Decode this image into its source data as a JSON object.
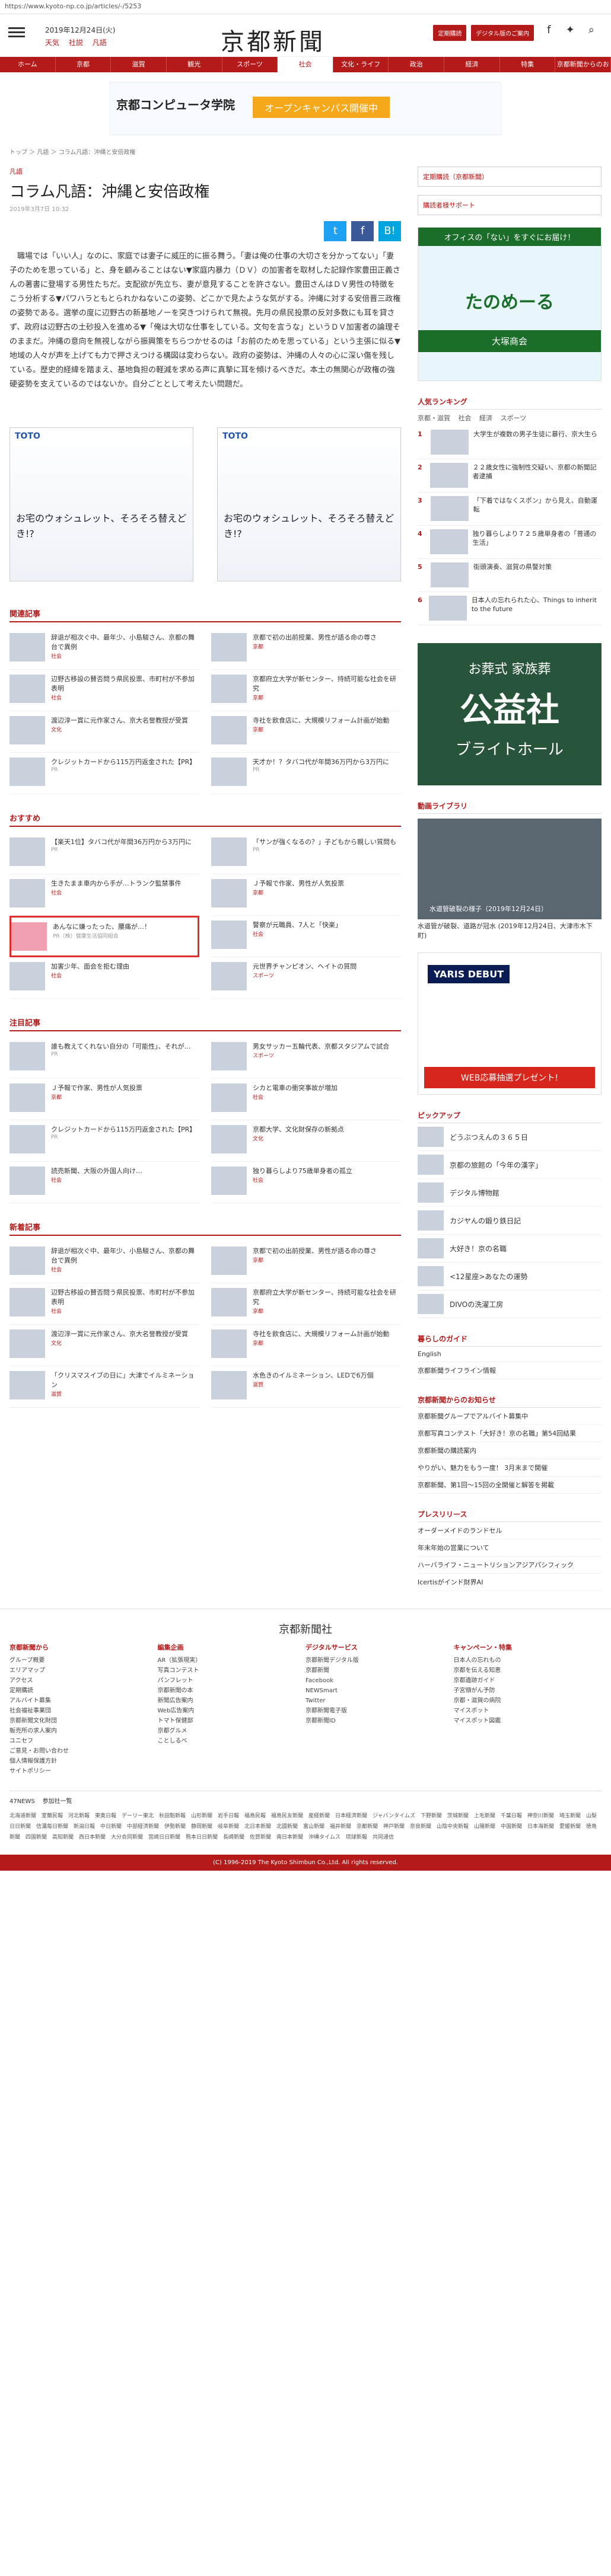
{
  "url": "https://www.kyoto-np.co.jp/articles/-/5253",
  "header": {
    "date": "2019年12月24日(火)",
    "links": [
      "天気",
      "社説",
      "凡語"
    ],
    "logo": "京都新聞",
    "buttons": [
      "定期購読",
      "デジタル版のご案内"
    ],
    "social": [
      "Facebook",
      "Twitter",
      "検索"
    ]
  },
  "nav": [
    "ホーム",
    "京都",
    "滋賀",
    "観光",
    "スポーツ",
    "社会",
    "文化・ライフ",
    "政治",
    "経済",
    "特集",
    "京都新聞からのお知らせ"
  ],
  "ad_banner": {
    "school": "京都コンピュータ学院",
    "text": "オープンキャンパス開催中"
  },
  "breadcrumb": "トップ ＞ 凡語 ＞ コラム凡語：沖縄と安倍政権",
  "article": {
    "category": "凡語",
    "title": "コラム凡語：沖縄と安倍政権",
    "date": "2019年3月7日 10:32",
    "body": "職場では「いい人」なのに、家庭では妻子に威圧的に振る舞う。「妻は俺の仕事の大切さを分かってない」「妻子のためを思っている」と、身を顧みることはない▼家庭内暴力（ＤＶ）の加害者を取材した記録作家豊田正義さんの著書に登場する男性たちだ。支配欲が先立ち、妻が意見することを許さない。豊田さんはＤＶ男性の特徴をこう分析する▼パワハラともとられかねないこの姿勢、どこかで見たような気がする。沖縄に対する安倍晋三政権の姿勢である。選挙の度に辺野古の新基地ノーを突きつけられて無視。先月の県民投票の反対多数にも耳を貸さず、政府は辺野古の土砂投入を進める▼「俺は大切な仕事をしている。文句を言うな」というＤＶ加害者の論理そのままだ。沖縄の意向を無視しながら振興策をちらつかせるのは「お前のためを思っている」という主張に似る▼地域の人々が声を上げても力で押さえつける構図は変わらない。政府の姿勢は、沖縄の人々の心に深い傷を残している。歴史的経緯を踏まえ、基地負担の軽減を求める声に真摯に耳を傾けるべきだ。本土の無関心が政権の強硬姿勢を支えているのではないか。自分ごととして考えたい問題だ。"
  },
  "share": [
    "t",
    "f",
    "B!"
  ],
  "ads_two": [
    {
      "brand": "TOTO",
      "copy": "お宅のウォシュレット、そろそろ替えどき!?"
    },
    {
      "brand": "TOTO",
      "copy": "お宅のウォシュレット、そろそろ替えどき!?"
    }
  ],
  "related": {
    "title": "関連記事",
    "items": [
      {
        "text": "辞退が相次ぐ中、最年少、小島駿さん、京都の舞台で異例",
        "meta": "社会"
      },
      {
        "text": "京都で初の出前授業、男性が語る命の尊さ",
        "meta": "京都"
      },
      {
        "text": "辺野古移設の賛否問う県民投票、市町村が不参加表明",
        "meta": "社会"
      },
      {
        "text": "京都府立大学が新センター、持続可能な社会を研究",
        "meta": "京都"
      },
      {
        "text": "渡辺淳一賞に元作家さん、京大名誉教授が受賞",
        "meta": "文化"
      },
      {
        "text": "寺社を飲食店に、大規模リフォーム計画が始動",
        "meta": "京都"
      },
      {
        "text": "クレジットカードから115万円返金された【PR】",
        "meta": "PR"
      },
      {
        "text": "天才か！？タバコ代が年間36万円から3万円に",
        "meta": "PR"
      }
    ]
  },
  "recommend": {
    "title": "おすすめ",
    "items": [
      {
        "text": "【楽天1位】タバコ代が年間36万円から3万円に",
        "meta": "PR"
      },
      {
        "text": "「サンが強くなるの？」子どもから親しい質問も",
        "meta": "PR"
      },
      {
        "text": "生きたまま車内から手が…トランク監禁事件",
        "meta": "社会"
      },
      {
        "text": "Ｊ予報で作家、男性が人気投票",
        "meta": "京都"
      },
      {
        "text": "あんなに嫌ったった、腰痛が…！",
        "meta": "PR（株）健康生活協同組合"
      },
      {
        "text": "警察が元職員、7人と「快楽」",
        "meta": "社会"
      },
      {
        "text": "加害少年、面会を拒む理由",
        "meta": "社会"
      },
      {
        "text": "元世界チャンピオン、ヘイトの質問",
        "meta": "スポーツ"
      }
    ]
  },
  "featured": {
    "title": "注目記事",
    "items": [
      {
        "text": "誰も教えてくれない自分の「可能性」、それが…",
        "meta": "PR"
      },
      {
        "text": "男女サッカー五輪代表、京都スタジアムで試合",
        "meta": "スポーツ"
      },
      {
        "text": "Ｊ予報で作家、男性が人気投票",
        "meta": "京都"
      },
      {
        "text": "シカと電車の衝突事故が増加",
        "meta": "社会"
      },
      {
        "text": "クレジットカードから115万円返金された【PR】",
        "meta": "PR"
      },
      {
        "text": "京都大学、文化財保存の新拠点",
        "meta": "文化"
      },
      {
        "text": "読売新聞、大阪の外国人向け…",
        "meta": "社会"
      },
      {
        "text": "独り暮らしより75歳単身者の孤立",
        "meta": "社会"
      }
    ]
  },
  "latest": {
    "title": "新着記事",
    "items": [
      {
        "text": "辞退が相次ぐ中、最年少、小島駿さん、京都の舞台で異例",
        "meta": "社会"
      },
      {
        "text": "京都で初の出前授業、男性が語る命の尊さ",
        "meta": "京都"
      },
      {
        "text": "辺野古移設の賛否問う県民投票、市町村が不参加表明",
        "meta": "社会"
      },
      {
        "text": "京都府立大学が新センター、持続可能な社会を研究",
        "meta": "京都"
      },
      {
        "text": "渡辺淳一賞に元作家さん、京大名誉教授が受賞",
        "meta": "文化"
      },
      {
        "text": "寺社を飲食店に、大規模リフォーム計画が始動",
        "meta": "京都"
      },
      {
        "text": "「クリスマスイブの日に」大津でイルミネーション",
        "meta": "滋賀"
      },
      {
        "text": "水色きのイルミネーション、LEDで6万個",
        "meta": "滋賀"
      }
    ]
  },
  "sidebar": {
    "links": [
      "定期購読（京都新聞）",
      "購読者様サポート"
    ],
    "tanomail": {
      "q": "オフィスの「ない」をすぐにお届け！",
      "name": "たのめーる",
      "shop": "大塚商会"
    },
    "ranking": {
      "title": "人気ランキング",
      "tabs": [
        "京都・滋賀",
        "社会",
        "経済",
        "スポーツ"
      ],
      "items": [
        "大学生が複数の男子生徒に暴行、京大生ら",
        "２２歳女性に強制性交疑い、京都の新聞記者逮捕",
        "「下着ではなくスポン」から見え、自動運転",
        "独り暮らしより７２５歳単身者の「普通の生活」",
        "街頭演奏、滋賀の県警対策",
        "日本人の忘れられた心、Things to inherit to the future"
      ]
    },
    "funeral": {
      "t1": "お葬式 家族葬",
      "t2": "公益社",
      "t3": "ブライトホール"
    },
    "video": {
      "title": "動画ライブラリ",
      "cap": "水道管破裂の様子（2019年12月24日）",
      "desc": "水道管が破裂、道路が冠水 (2019年12月24日、大津市木下町)"
    },
    "yaris": {
      "t1": "YARIS DEBUT",
      "t2": "WEB応募抽選プレゼント!"
    },
    "pickup": {
      "title": "ピックアップ",
      "items": [
        "どうぶつえんの３６５日",
        "京都の旅館の「今年の漢字」",
        "デジタル博物館",
        "カジヤんの鍛り鉄日記",
        "大好き！京の名職",
        "<12星座>あなたの運勢",
        "DIVOの洗濯工房"
      ]
    },
    "guide": {
      "title": "暮らしのガイド",
      "items": [
        "English",
        "京都新聞ライフライン情報"
      ]
    },
    "notices": {
      "title": "京都新聞からのお知らせ",
      "items": [
        "京都新聞グループでアルバイト募集中",
        "京都写真コンテスト「大好き！京の名職」第54回結果",
        "京都新聞の購読案内",
        "やりがい、魅力をもう一度！ 3月末まで開催",
        "京都新聞、第1回〜15回の全開催と解答を掲載"
      ]
    },
    "press": {
      "title": "プレスリリース",
      "items": [
        "オーダーメイドのランドセル",
        "年末年始の営業について",
        "ハーバライフ・ニュートリションアジアパシフィック",
        "Icertisがインド財界AI"
      ]
    }
  },
  "footer": {
    "logo": "京都新聞社",
    "cols": [
      {
        "h": "京都新聞から",
        "items": [
          "グループ概要",
          "エリアマップ",
          "アクセス",
          "定期購読",
          "アルバイト募集",
          "社会福祉事業団",
          "京都新聞文化財団",
          "販売所の求人案内",
          "ユニセフ",
          "ご意見・お問い合わせ",
          "個人情報保護方針",
          "サイトポリシー"
        ]
      },
      {
        "h": "編集企画",
        "items": [
          "AR（拡張現実）",
          "写真コンテスト",
          "パンフレット",
          "京都新聞の本",
          "新聞広告案内",
          "Web広告案内",
          "トマト保健部",
          "京都グルメ",
          "ことしるべ"
        ]
      },
      {
        "h": "デジタルサービス",
        "items": [
          "京都新聞デジタル版",
          "京都新聞",
          "Facebook",
          "NEWSmart",
          "Twitter",
          "京都新聞電子版",
          "京都新聞ID"
        ]
      },
      {
        "h": "キャンペーン・特集",
        "items": [
          "日本人の忘れもの",
          "京都を伝える知恵",
          "京都遺跡ガイド",
          "子宮頸がん予防",
          "京都・滋賀の病院",
          "マイスポット",
          "マイスポット図鑑"
        ]
      }
    ],
    "f47": [
      "47NEWS",
      "参加社一覧"
    ],
    "f47links": "北海道新聞　室蘭民報　河北新報　東奥日報　デーリー東北　秋田魁新報　山形新聞　岩手日報　福島民報　福島民友新聞　産経新聞　日本経済新聞　ジャパンタイムズ　下野新聞　茨城新聞　上毛新聞　千葉日報　神奈川新聞　埼玉新聞　山梨日日新聞　信濃毎日新聞　新潟日報　中日新聞　中部経済新聞　伊勢新聞　静岡新聞　岐阜新聞　北日本新聞　北國新聞　富山新聞　福井新聞　京都新聞　神戸新聞　奈良新聞　山陰中央新報　山陽新聞　中国新聞　日本海新聞　愛媛新聞　徳島新聞　四国新聞　高知新聞　西日本新聞　大分合同新聞　宮崎日日新聞　熊本日日新聞　長崎新聞　佐賀新聞　南日本新聞　沖縄タイムス　琉球新報　共同通信",
    "copyright": "(C) 1996-2019 The Kyoto Shimbun Co.,Ltd. All rights reserved."
  }
}
